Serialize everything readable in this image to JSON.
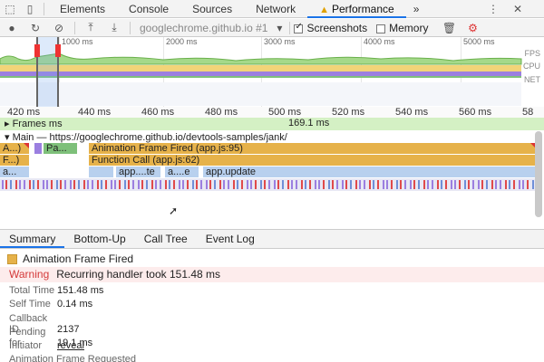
{
  "devtools_tabs": [
    "Elements",
    "Console",
    "Sources",
    "Network",
    "Performance"
  ],
  "overflow_label": "»",
  "perf_toolbar": {
    "url": "googlechrome.github.io #1",
    "screenshots_label": "Screenshots",
    "memory_label": "Memory",
    "screenshots_checked": true,
    "memory_checked": false
  },
  "overview": {
    "ticks": [
      "1000 ms",
      "2000 ms",
      "3000 ms",
      "4000 ms",
      "5000 ms"
    ],
    "labels": [
      "FPS",
      "CPU",
      "NET"
    ]
  },
  "time_ruler": [
    "420 ms",
    "440 ms",
    "460 ms",
    "480 ms",
    "500 ms",
    "520 ms",
    "540 ms",
    "560 ms",
    "58"
  ],
  "frames": {
    "label": "Frames",
    "prefix": "ms",
    "value": "169.1 ms"
  },
  "main": {
    "label": "Main — https://googlechrome.github.io/devtools-samples/jank/"
  },
  "flame": {
    "row1": [
      "A...)",
      "Pa...",
      "Animation Frame Fired (app.js:95)"
    ],
    "row2": [
      "F...)",
      "Function Call (app.js:62)"
    ],
    "row3": [
      "a...",
      "app....te",
      "a....e",
      "app.update"
    ]
  },
  "details_tabs": [
    "Summary",
    "Bottom-Up",
    "Call Tree",
    "Event Log"
  ],
  "summary": {
    "title": "Animation Frame Fired",
    "warning_label": "Warning",
    "warning_text": "Recurring handler took 151.48 ms",
    "rows": [
      {
        "k": "Total Time",
        "v": "151.48 ms"
      },
      {
        "k": "Self Time",
        "v": "0.14 ms"
      },
      {
        "k": "Callback ID",
        "v": "2137"
      },
      {
        "k": "Pending for",
        "v": "19.1 ms"
      },
      {
        "k": "Initiator",
        "v": "reveal"
      }
    ],
    "footer": "Animation Frame Requested"
  },
  "colors": {
    "accent": "#1a73e8",
    "scripting": "#e6b24a",
    "warning": "#d43a3a",
    "frames": "#d4f0c4"
  }
}
